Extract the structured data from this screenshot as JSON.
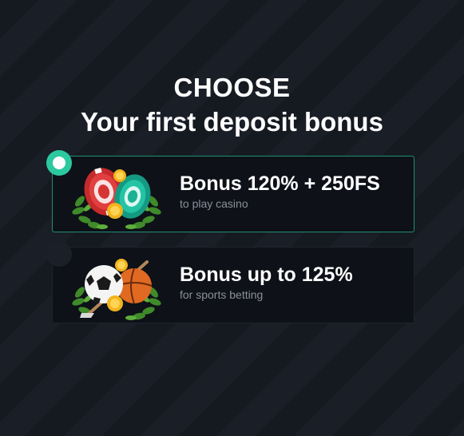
{
  "header": {
    "line1": "CHOOSE",
    "line2": "Your first deposit bonus"
  },
  "options": [
    {
      "title": "Bonus 120% + 250FS",
      "subtitle": "to play casino",
      "selected": true,
      "icon": "casino-chips-icon"
    },
    {
      "title": "Bonus up to 125%",
      "subtitle": "for sports betting",
      "selected": false,
      "icon": "sports-balls-icon"
    }
  ],
  "colors": {
    "accent": "#2cc9a0",
    "card_bg": "#0e1118",
    "subtitle": "#8a8f9a"
  }
}
